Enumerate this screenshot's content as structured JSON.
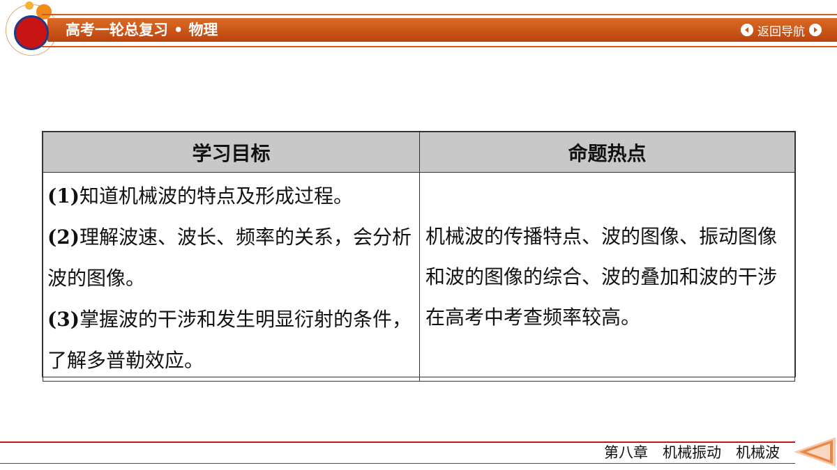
{
  "header": {
    "course": "高考一轮总复习",
    "bullet": "•",
    "subject": "物理",
    "nav_label": "返回导航"
  },
  "table": {
    "headers": [
      "学习目标",
      "命题热点"
    ],
    "goals": [
      {
        "num": "(1)",
        "text": "知道机械波的特点及形成过程。"
      },
      {
        "num": "(2)",
        "text": "理解波速、波长、频率的关系，会分析波的图像。"
      },
      {
        "num": "(3)",
        "text": "掌握波的干涉和发生明显衍射的条件，了解多普勒效应。"
      }
    ],
    "hotspot": "机械波的传播特点、波的图像、振动图像和波的图像的综合、波的叠加和波的干涉在高考中考查频率较高。"
  },
  "footer": {
    "chapter": "第八章　机械振动　机械波"
  },
  "colors": {
    "header_bar": "#c9531a",
    "logo_red": "#c81414",
    "table_header_bg": "#c8c8c8",
    "footer_line": "#c01818"
  },
  "icons": [
    "nav-prev-icon",
    "nav-next-icon",
    "back-arrow-icon"
  ]
}
